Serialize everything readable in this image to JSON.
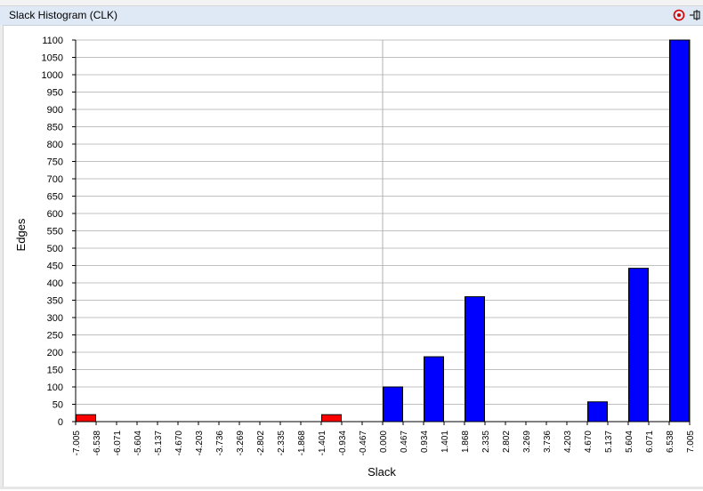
{
  "window": {
    "title": "Slack Histogram (CLK)",
    "close_icon": "target-close-icon",
    "pin_icon": "pin-icon"
  },
  "colors": {
    "negative_bar": "#ff0000",
    "positive_bar": "#0000ff",
    "titlebar": "#dfe9f5",
    "grid": "#c0c0c0"
  },
  "chart_data": {
    "type": "bar",
    "xlabel": "Slack",
    "ylabel": "Edges",
    "ylim": [
      0,
      1100
    ],
    "yticks": [
      0,
      50,
      100,
      150,
      200,
      250,
      300,
      350,
      400,
      450,
      500,
      550,
      600,
      650,
      700,
      750,
      800,
      850,
      900,
      950,
      1000,
      1050,
      1100
    ],
    "xticks": [
      "-7.005",
      "-6.538",
      "-6.071",
      "-5.604",
      "-5.137",
      "-4.670",
      "-4.203",
      "-3.736",
      "-3.269",
      "-2.802",
      "-2.335",
      "-1.868",
      "-1.401",
      "-0.934",
      "-0.467",
      "0.000",
      "0.467",
      "0.934",
      "1.401",
      "1.868",
      "2.335",
      "2.802",
      "3.269",
      "3.736",
      "4.203",
      "4.670",
      "5.137",
      "5.604",
      "6.071",
      "6.538",
      "7.005"
    ],
    "bars": [
      {
        "from": -7.005,
        "to": -6.538,
        "value": 20,
        "color": "#ff0000"
      },
      {
        "from": -1.401,
        "to": -0.934,
        "value": 20,
        "color": "#ff0000"
      },
      {
        "from": 0.0,
        "to": 0.467,
        "value": 100,
        "color": "#0000ff"
      },
      {
        "from": 0.934,
        "to": 1.401,
        "value": 187,
        "color": "#0000ff"
      },
      {
        "from": 1.868,
        "to": 2.335,
        "value": 360,
        "color": "#0000ff"
      },
      {
        "from": 4.67,
        "to": 5.137,
        "value": 57,
        "color": "#0000ff"
      },
      {
        "from": 5.604,
        "to": 6.071,
        "value": 442,
        "color": "#0000ff"
      },
      {
        "from": 6.538,
        "to": 7.005,
        "value": 1100,
        "color": "#0000ff"
      }
    ],
    "grid": true,
    "zero_line": 0.0
  }
}
